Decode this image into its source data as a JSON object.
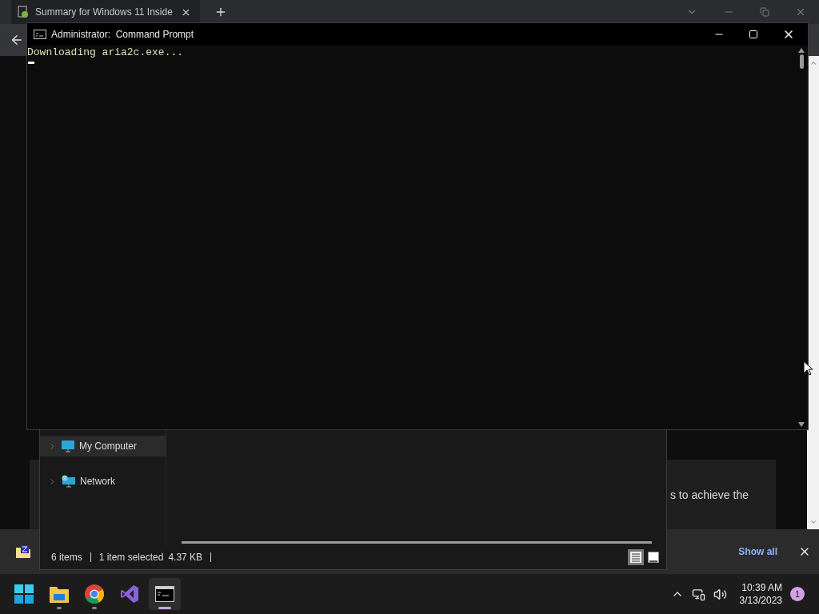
{
  "browser": {
    "tab_title": "Summary for Windows 11 Inside",
    "page_text": "s to achieve the",
    "download_link": "Show all"
  },
  "explorer": {
    "nav": [
      {
        "label": "My Computer",
        "kind": "computer",
        "selected": true
      },
      {
        "label": "Network",
        "kind": "network",
        "selected": false
      }
    ],
    "status": {
      "items": "6 items",
      "selection": "1 item selected",
      "size": "4.37 KB"
    },
    "views": [
      {
        "kind": "details",
        "selected": true
      },
      {
        "kind": "preview",
        "selected": false
      }
    ]
  },
  "console": {
    "title": "Administrator:  Command Prompt",
    "lines": [
      "Downloading aria2c.exe..."
    ]
  },
  "taskbar": {
    "apps": [
      {
        "kind": "start",
        "running": false,
        "selected": false
      },
      {
        "kind": "folder",
        "running": true,
        "selected": false
      },
      {
        "kind": "browser",
        "running": true,
        "selected": false
      },
      {
        "kind": "studio",
        "running": false,
        "selected": false
      },
      {
        "kind": "terminal",
        "running": true,
        "selected": true
      }
    ],
    "time": "10:39 AM",
    "date": "3/13/2023",
    "badge": "1"
  }
}
